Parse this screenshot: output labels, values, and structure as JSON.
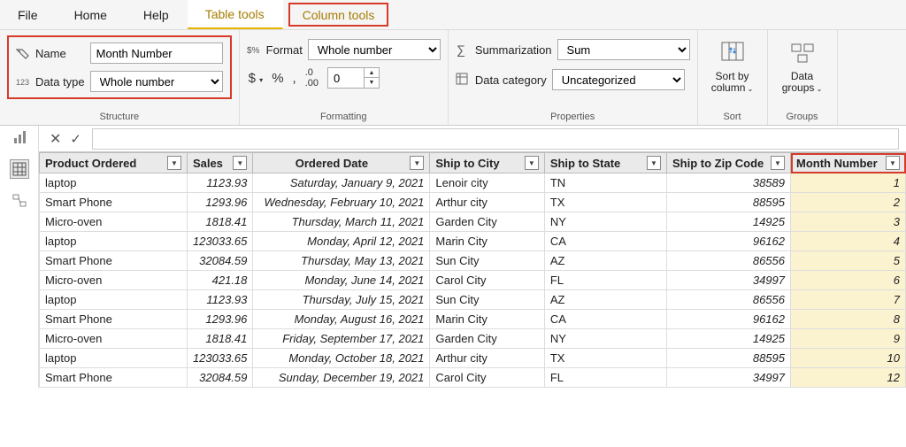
{
  "tabs": {
    "file": "File",
    "home": "Home",
    "help": "Help",
    "table_tools": "Table tools",
    "column_tools": "Column tools"
  },
  "ribbon": {
    "structure": {
      "name_label": "Name",
      "name_value": "Month Number",
      "datatype_label": "Data type",
      "datatype_value": "Whole number",
      "group_label": "Structure"
    },
    "formatting": {
      "format_label": "Format",
      "format_value": "Whole number",
      "decimals_value": "0",
      "currency_sym": "$",
      "percent_sym": "%",
      "comma_sym": ",",
      "dec_sym": ".00",
      "group_label": "Formatting"
    },
    "properties": {
      "summ_label": "Summarization",
      "summ_value": "Sum",
      "cat_label": "Data category",
      "cat_value": "Uncategorized",
      "group_label": "Properties"
    },
    "sort": {
      "btn_line1": "Sort by",
      "btn_line2": "column",
      "group_label": "Sort"
    },
    "groups": {
      "btn_line1": "Data",
      "btn_line2": "groups",
      "group_label": "Groups"
    }
  },
  "grid": {
    "headers": {
      "product": "Product Ordered",
      "sales": "Sales",
      "date": "Ordered Date",
      "city": "Ship to City",
      "state": "Ship to State",
      "zip": "Ship to Zip Code",
      "month": "Month Number"
    },
    "rows": [
      {
        "product": "laptop",
        "sales": "1123.93",
        "date": "Saturday, January 9, 2021",
        "city": "Lenoir city",
        "state": "TN",
        "zip": "38589",
        "month": "1"
      },
      {
        "product": "Smart Phone",
        "sales": "1293.96",
        "date": "Wednesday, February 10, 2021",
        "city": "Arthur city",
        "state": "TX",
        "zip": "88595",
        "month": "2"
      },
      {
        "product": "Micro-oven",
        "sales": "1818.41",
        "date": "Thursday, March 11, 2021",
        "city": "Garden City",
        "state": "NY",
        "zip": "14925",
        "month": "3"
      },
      {
        "product": "laptop",
        "sales": "123033.65",
        "date": "Monday, April 12, 2021",
        "city": "Marin City",
        "state": "CA",
        "zip": "96162",
        "month": "4"
      },
      {
        "product": "Smart Phone",
        "sales": "32084.59",
        "date": "Thursday, May 13, 2021",
        "city": "Sun City",
        "state": "AZ",
        "zip": "86556",
        "month": "5"
      },
      {
        "product": "Micro-oven",
        "sales": "421.18",
        "date": "Monday, June 14, 2021",
        "city": "Carol City",
        "state": "FL",
        "zip": "34997",
        "month": "6"
      },
      {
        "product": "laptop",
        "sales": "1123.93",
        "date": "Thursday, July 15, 2021",
        "city": "Sun City",
        "state": "AZ",
        "zip": "86556",
        "month": "7"
      },
      {
        "product": "Smart Phone",
        "sales": "1293.96",
        "date": "Monday, August 16, 2021",
        "city": "Marin City",
        "state": "CA",
        "zip": "96162",
        "month": "8"
      },
      {
        "product": "Micro-oven",
        "sales": "1818.41",
        "date": "Friday, September 17, 2021",
        "city": "Garden City",
        "state": "NY",
        "zip": "14925",
        "month": "9"
      },
      {
        "product": "laptop",
        "sales": "123033.65",
        "date": "Monday, October 18, 2021",
        "city": "Arthur city",
        "state": "TX",
        "zip": "88595",
        "month": "10"
      },
      {
        "product": "Smart Phone",
        "sales": "32084.59",
        "date": "Sunday, December 19, 2021",
        "city": "Carol City",
        "state": "FL",
        "zip": "34997",
        "month": "12"
      }
    ]
  }
}
